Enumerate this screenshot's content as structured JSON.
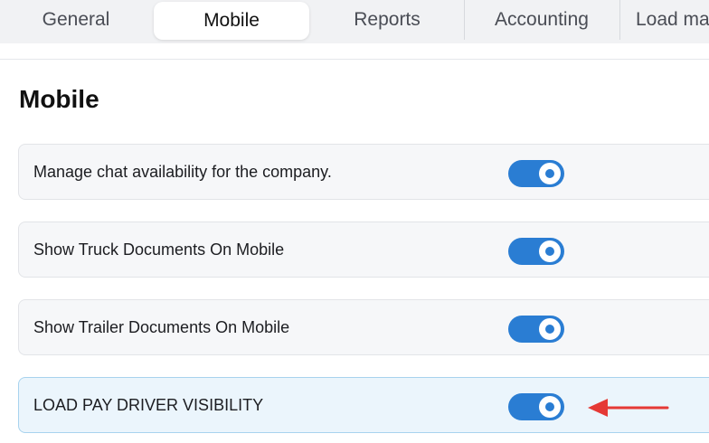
{
  "tabs": [
    {
      "label": "General",
      "active": false
    },
    {
      "label": "Mobile",
      "active": true
    },
    {
      "label": "Reports",
      "active": false
    },
    {
      "label": "Accounting",
      "active": false
    },
    {
      "label": "Load ma",
      "active": false
    }
  ],
  "page": {
    "title": "Mobile"
  },
  "settings": [
    {
      "label": "Manage chat availability for the company.",
      "enabled": true
    },
    {
      "label": "Show Truck Documents On Mobile",
      "enabled": true
    },
    {
      "label": "Show Trailer Documents On Mobile",
      "enabled": true
    },
    {
      "label": "LOAD PAY DRIVER VISIBILITY",
      "enabled": true
    }
  ],
  "colors": {
    "accent": "#2a7dd3",
    "highlight_bg": "#ebf5fc",
    "annotation_arrow": "#e53935"
  },
  "icons": {
    "annotation": "red-arrow-icon"
  }
}
